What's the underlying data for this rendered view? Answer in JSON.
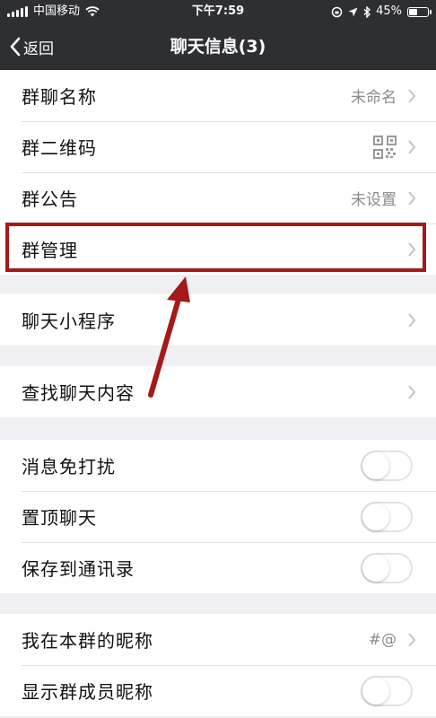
{
  "status_bar": {
    "carrier": "中国移动",
    "time": "下午7:59",
    "battery_percent": "45%",
    "battery_level": 0.45
  },
  "nav": {
    "back_label": "返回",
    "title": "聊天信息(3)"
  },
  "groups": [
    {
      "items": [
        {
          "label": "群聊名称",
          "value": "未命名"
        },
        {
          "label": "群二维码",
          "icon": "qr-code-icon"
        },
        {
          "label": "群公告",
          "value": "未设置"
        },
        {
          "label": "群管理"
        }
      ]
    },
    {
      "items": [
        {
          "label": "聊天小程序"
        }
      ]
    },
    {
      "items": [
        {
          "label": "查找聊天内容"
        }
      ]
    },
    {
      "items": [
        {
          "label": "消息免打扰",
          "toggle": false
        },
        {
          "label": "置顶聊天",
          "toggle": false
        },
        {
          "label": "保存到通讯录",
          "toggle": false
        }
      ]
    },
    {
      "items": [
        {
          "label": "我在本群的昵称",
          "value": "#@"
        },
        {
          "label": "显示群成员昵称",
          "toggle": false
        }
      ]
    }
  ],
  "annotation": {
    "highlight_color": "#a41a19",
    "highlighted_item": "群管理"
  }
}
